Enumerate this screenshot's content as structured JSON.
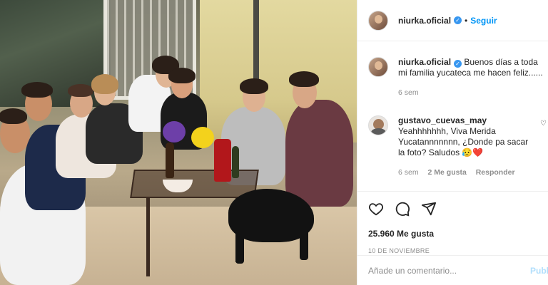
{
  "post": {
    "username": "niurka.oficial",
    "follow_label": "Seguir",
    "dot": "•"
  },
  "caption": {
    "username": "niurka.oficial",
    "text": "Buenos días a toda mi familia yucateca me hacen feliz......",
    "time": "6 sem"
  },
  "comment": {
    "username": "gustavo_cuevas_may",
    "text": "Yeahhhhhhh, Viva Merida Yucatannnnnnn, ¿Donde pa sacar la foto? Saludos",
    "emoji1": "😥",
    "emoji2": "❤️",
    "time": "6 sem",
    "likes": "2 Me gusta",
    "reply_label": "Responder"
  },
  "actions": {
    "likes_count": "25.960 Me gusta",
    "date": "10 DE NOVIEMBRE"
  },
  "add_comment": {
    "placeholder": "Añade un comentario...",
    "publish_label": "Publicar"
  },
  "icons": {
    "like": "heart-icon",
    "comment": "comment-icon",
    "share": "share-icon",
    "save": "bookmark-icon",
    "verified": "verified-badge-icon",
    "comment_like": "heart-outline-icon"
  },
  "colors": {
    "accent": "#0095f6",
    "verified": "#3897f0",
    "muted": "#8e8e8e",
    "publish_disabled": "#b2dffc"
  }
}
